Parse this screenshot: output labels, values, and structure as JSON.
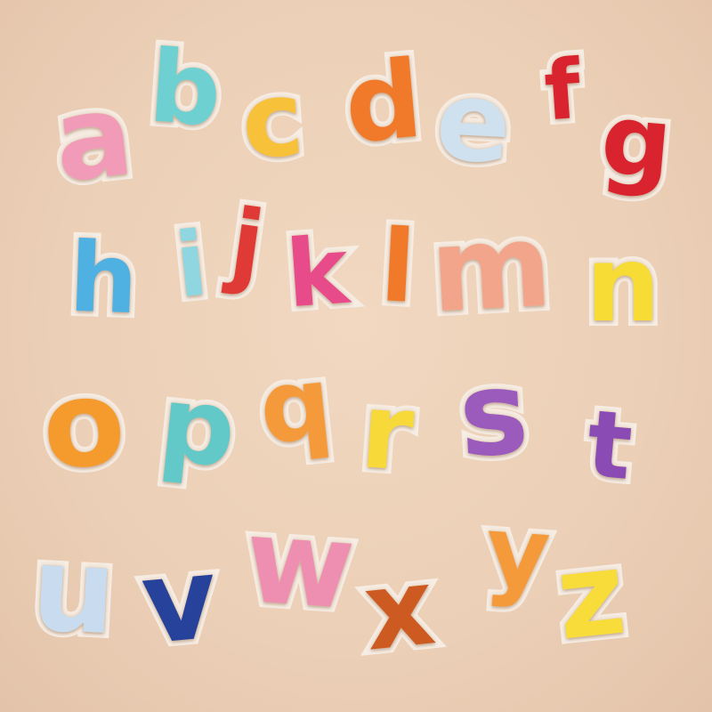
{
  "patches": [
    {
      "letter": "a",
      "color": "#f19bb8"
    },
    {
      "letter": "b",
      "color": "#6fd0d2"
    },
    {
      "letter": "c",
      "color": "#f7c13a"
    },
    {
      "letter": "d",
      "color": "#f07a2a"
    },
    {
      "letter": "e",
      "color": "#cfe0ef"
    },
    {
      "letter": "f",
      "color": "#d9242f"
    },
    {
      "letter": "g",
      "color": "#d9242f"
    },
    {
      "letter": "h",
      "color": "#4fb0e2"
    },
    {
      "letter": "i",
      "color": "#8fd6e0"
    },
    {
      "letter": "j",
      "color": "#e03a36"
    },
    {
      "letter": "k",
      "color": "#e84b8a"
    },
    {
      "letter": "l",
      "color": "#f07a2a"
    },
    {
      "letter": "m",
      "color": "#f3a58c"
    },
    {
      "letter": "n",
      "color": "#f7dc36"
    },
    {
      "letter": "o",
      "color": "#f59a2c"
    },
    {
      "letter": "p",
      "color": "#62c9c8"
    },
    {
      "letter": "q",
      "color": "#f59a3a"
    },
    {
      "letter": "r",
      "color": "#f7d93a"
    },
    {
      "letter": "s",
      "color": "#9b5bbd"
    },
    {
      "letter": "t",
      "color": "#8a4cb4"
    },
    {
      "letter": "u",
      "color": "#c9dbee"
    },
    {
      "letter": "v",
      "color": "#27429a"
    },
    {
      "letter": "w",
      "color": "#ee8fb2"
    },
    {
      "letter": "x",
      "color": "#cd5a20"
    },
    {
      "letter": "y",
      "color": "#f59a3a"
    },
    {
      "letter": "z",
      "color": "#f7dc3a"
    }
  ],
  "outline_color": "#f6ede4",
  "stitch_color": "#e2cbb4"
}
